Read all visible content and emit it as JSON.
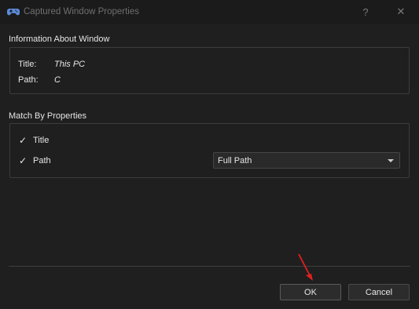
{
  "window": {
    "title": "Captured Window Properties",
    "help_label": "?",
    "close_label": "✕"
  },
  "info_section": {
    "heading": "Information About Window",
    "rows": [
      {
        "key": "Title:",
        "value": "This PC"
      },
      {
        "key": "Path:",
        "value": "C"
      }
    ]
  },
  "match_section": {
    "heading": "Match By Properties",
    "checks": [
      {
        "label": "Title",
        "checked": true
      },
      {
        "label": "Path",
        "checked": true
      }
    ],
    "path_mode": {
      "selected": "Full Path"
    },
    "checkmark": "✓"
  },
  "buttons": {
    "ok": "OK",
    "cancel": "Cancel"
  },
  "colors": {
    "background": "#1f1f1f",
    "annotation_arrow": "#e02020",
    "app_icon": "#5b8bd9"
  }
}
